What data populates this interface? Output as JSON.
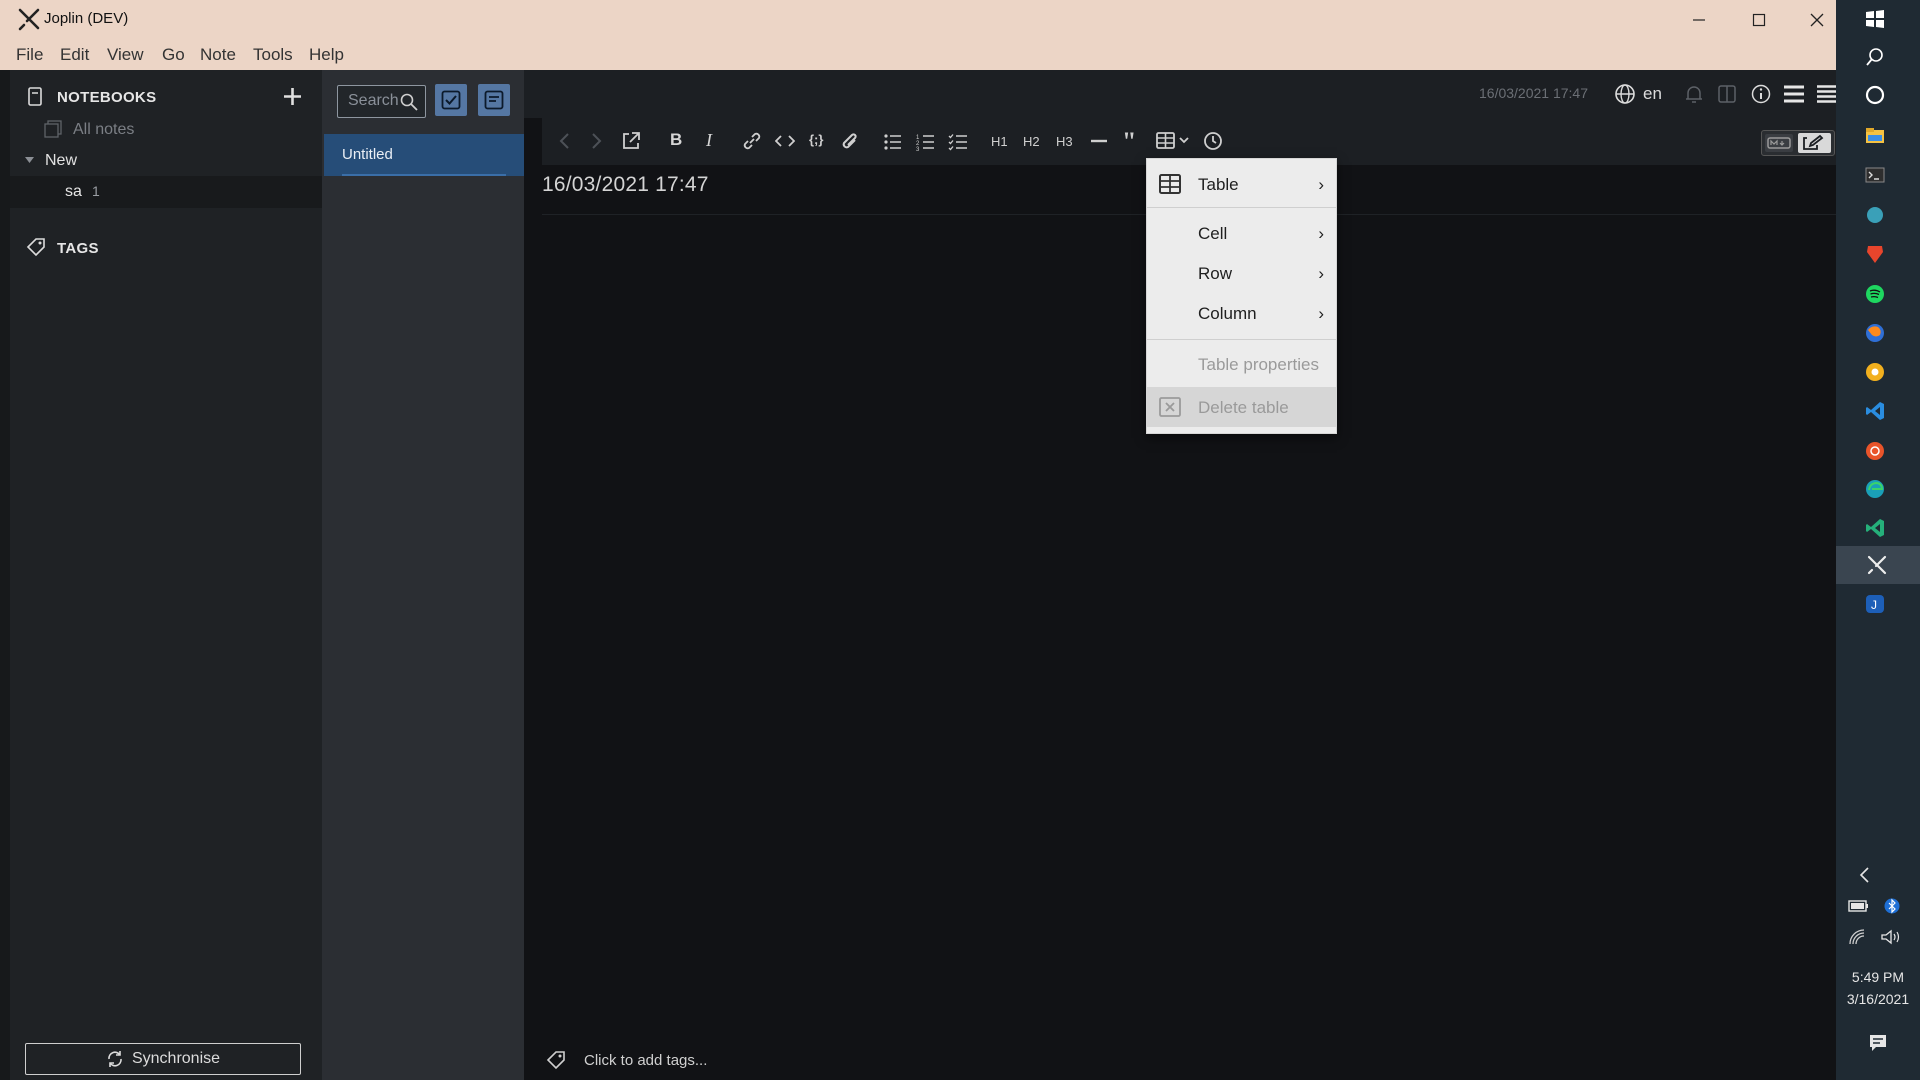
{
  "window": {
    "title": "Joplin (DEV)"
  },
  "menubar": [
    "File",
    "Edit",
    "View",
    "Go",
    "Note",
    "Tools",
    "Help"
  ],
  "sidebar": {
    "notebooks_heading": "NOTEBOOKS",
    "all_notes": "All notes",
    "folder": "New",
    "subfolder": "sa",
    "subfolder_count": "1",
    "tags_heading": "TAGS",
    "sync_label": "Synchronise"
  },
  "notelist": {
    "search_placeholder": "Search...",
    "notes": [
      {
        "title": "Untitled"
      }
    ]
  },
  "editor": {
    "timestamp": "16/03/2021 17:47",
    "language": "en",
    "note_title": "16/03/2021 17:47",
    "tags_placeholder": "Click to add tags...",
    "toolbar_headings": [
      "H1",
      "H2",
      "H3"
    ]
  },
  "table_menu": {
    "items": [
      {
        "label": "Table",
        "submenu": true,
        "enabled": true
      },
      {
        "label": "Cell",
        "submenu": true,
        "enabled": true
      },
      {
        "label": "Row",
        "submenu": true,
        "enabled": true
      },
      {
        "label": "Column",
        "submenu": true,
        "enabled": true
      },
      {
        "label": "Table properties",
        "submenu": false,
        "enabled": false
      },
      {
        "label": "Delete table",
        "submenu": false,
        "enabled": false
      }
    ]
  },
  "taskbar": {
    "time": "5:49 PM",
    "date": "3/16/2021"
  },
  "colors": {
    "accent": "#5577a3",
    "selected_note": "#264d78",
    "titlebar": "#ecd5c6",
    "editor_bg": "#111215"
  }
}
